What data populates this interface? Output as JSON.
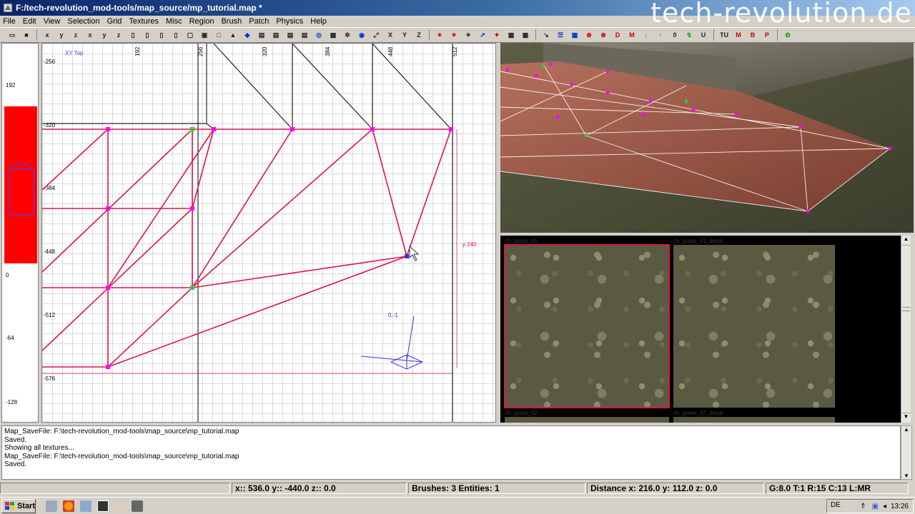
{
  "window": {
    "title": "F:/tech-revolution_mod-tools/map_source/mp_tutorial.map *",
    "watermark": "tech-revolution.de"
  },
  "menu": [
    "File",
    "Edit",
    "View",
    "Selection",
    "Grid",
    "Textures",
    "Misc",
    "Region",
    "Brush",
    "Patch",
    "Physics",
    "Help"
  ],
  "grid2d": {
    "view_label": "XY Top",
    "x_ticks": [
      "192",
      "256",
      "320",
      "384",
      "448",
      "512",
      "576"
    ],
    "y_ticks": [
      "-256",
      "-320",
      "-384",
      "-448",
      "-512",
      "-576"
    ],
    "y_dim_label": "y:240",
    "axis_label": "0,-1"
  },
  "zruler": {
    "ticks": [
      "192",
      "0",
      "-64",
      "-128"
    ]
  },
  "textures": [
    {
      "name": "ch_grass_01",
      "selected": true
    },
    {
      "name": "ch_grass_01_decal",
      "selected": false
    },
    {
      "name": "ch_grass_02",
      "selected": false
    },
    {
      "name": "ch_grass_02_decal",
      "selected": false
    }
  ],
  "console_lines": [
    "Map_SaveFile: F:\\tech-revolution_mod-tools\\map_source\\mp_tutorial.map",
    "Saved.",
    "Showing all textures...",
    "Map_SaveFile: F:\\tech-revolution_mod-tools\\map_source\\mp_tutorial.map",
    "Saved."
  ],
  "status": {
    "coords": "x:: 536.0  y:: -440.0  z:: 0.0",
    "counts": "Brushes: 3 Entities: 1",
    "distance": "Distance x: 216.0  y: 112.0  z: 0.0",
    "grid": "G:8.0 T:1 R:15 C:13 L:MR"
  },
  "taskbar": {
    "start_label": "Start",
    "language": "DE",
    "clock": "13:26"
  },
  "colors": {
    "patch_lines": "#e0144c",
    "vertex": "#ff00ff",
    "selected_vertex": "#33cc33",
    "title_gradient_start": "#0a246a"
  }
}
